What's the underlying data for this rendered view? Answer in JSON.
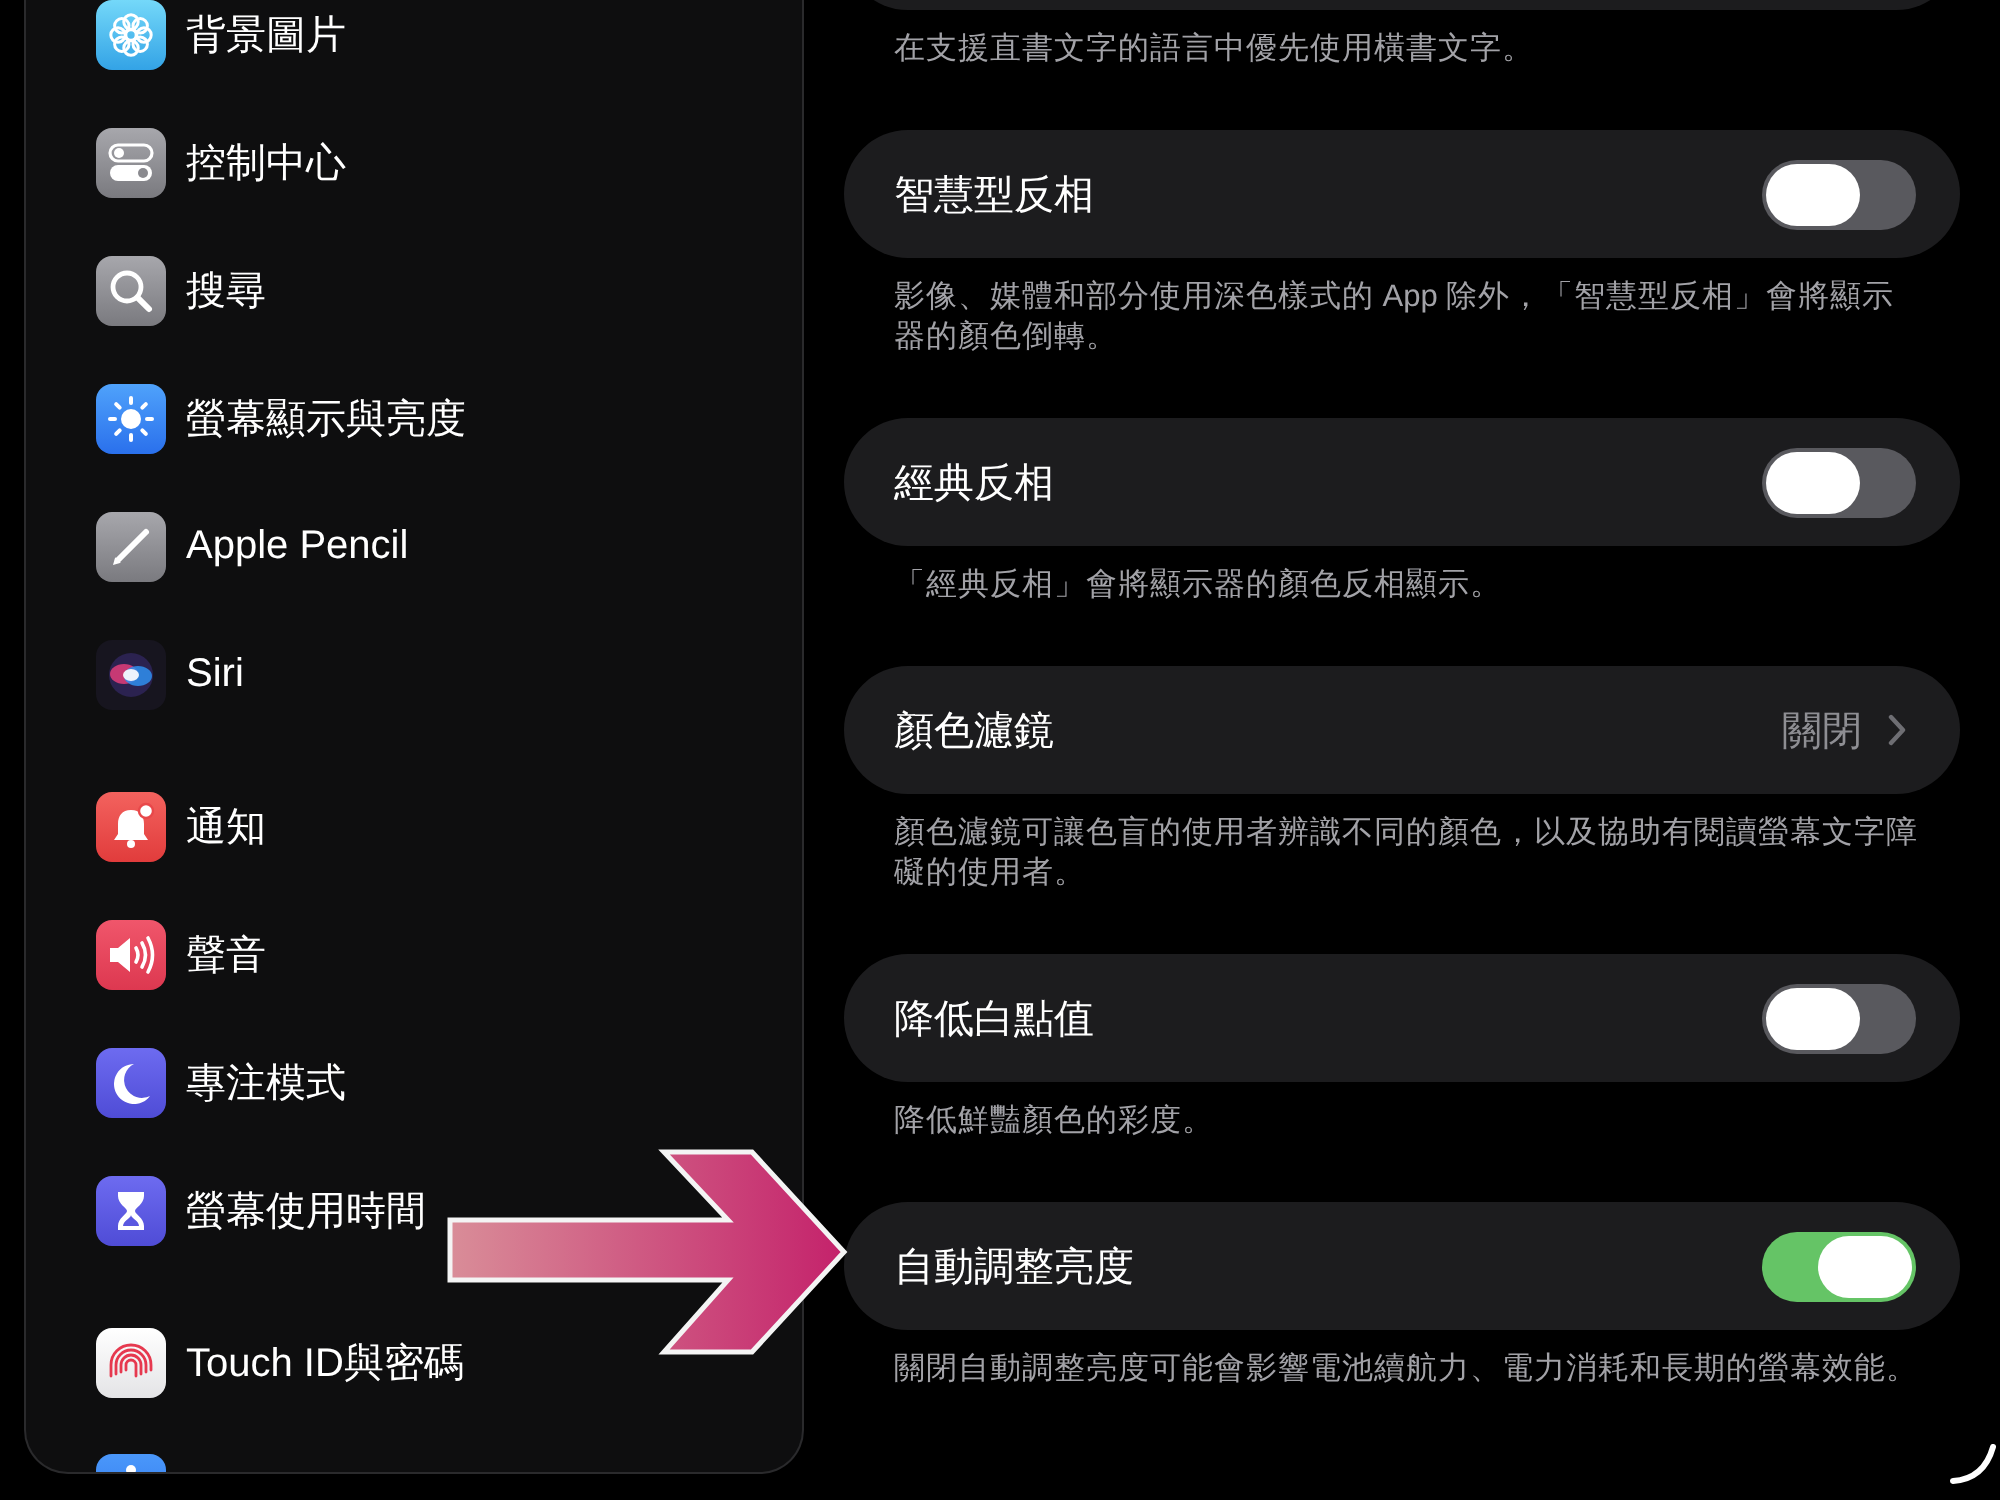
{
  "sidebar": {
    "groups": [
      {
        "items": [
          {
            "label": "背景圖片",
            "selected": false
          },
          {
            "label": "控制中心",
            "selected": false
          },
          {
            "label": "搜尋",
            "selected": false
          },
          {
            "label": "螢幕顯示與亮度",
            "selected": false
          },
          {
            "label": "Apple Pencil",
            "selected": false
          },
          {
            "label": "Siri",
            "selected": false
          }
        ]
      },
      {
        "items": [
          {
            "label": "通知",
            "selected": false
          },
          {
            "label": "聲音",
            "selected": false
          },
          {
            "label": "專注模式",
            "selected": false
          },
          {
            "label": "螢幕使用時間",
            "selected": false
          }
        ]
      },
      {
        "items": [
          {
            "label": "Touch ID與密碼",
            "selected": false
          }
        ]
      }
    ]
  },
  "settings": [
    {
      "footer": "在支援直書文字的語言中優先使用橫書文字。"
    },
    {
      "kind": "toggle",
      "title": "智慧型反相",
      "on": false,
      "footer": "影像、媒體和部分使用深色樣式的 App 除外，「智慧型反相」會將顯示器的顏色倒轉。"
    },
    {
      "kind": "toggle",
      "title": "經典反相",
      "on": false,
      "footer": "「經典反相」會將顯示器的顏色反相顯示。"
    },
    {
      "kind": "link",
      "title": "顏色濾鏡",
      "value": "關閉",
      "footer": "顏色濾鏡可讓色盲的使用者辨識不同的顏色，以及協助有閱讀螢幕文字障礙的使用者。"
    },
    {
      "kind": "toggle",
      "title": "降低白點值",
      "on": false,
      "footer": "降低鮮豔顏色的彩度。"
    },
    {
      "kind": "toggle",
      "title": "自動調整亮度",
      "on": true,
      "footer": "關閉自動調整亮度可能會影響電池續航力、電力消耗和長期的螢幕效能。"
    }
  ],
  "annotation": {
    "kind": "arrow"
  }
}
